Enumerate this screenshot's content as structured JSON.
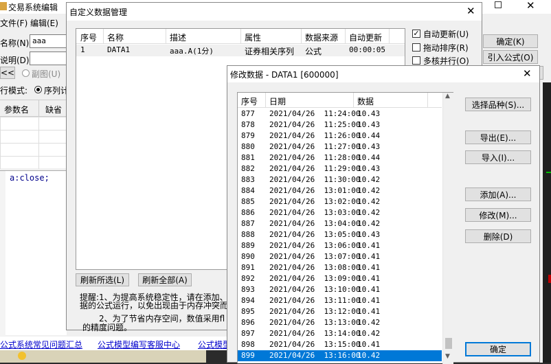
{
  "bg_window": {
    "title": "交易系统编辑",
    "menu_file": "文件(F)",
    "menu_edit": "编辑(E)",
    "name_label": "名称(N):",
    "name_value": "aaa",
    "desc_label": "说明(D):",
    "nav_back": "<<",
    "radio_subchart": "副图(U)",
    "run_mode_label": "行模式:",
    "radio_sequence": "序列计",
    "param_name_col": "参数名",
    "default_col": "缺省",
    "code_text": "a:close;",
    "link_faq": "公式系统常见问题汇总",
    "link_service": "公式模型编写客服中心",
    "link_other": "公式模型",
    "btn_ok": "确定(K)",
    "btn_import": "引入公式(O)"
  },
  "custom_data_dialog": {
    "title": "自定义数据管理",
    "columns": [
      "序号",
      "名称",
      "描述",
      "属性",
      "数据来源",
      "自动更新"
    ],
    "rows": [
      [
        "1",
        "DATA1",
        "aaa.A(1分)",
        "证券相关序列",
        "公式",
        "00:00:05"
      ]
    ],
    "options": [
      {
        "label": "自动更新(U)",
        "checked": true
      },
      {
        "label": "拖动排序(R)",
        "checked": false
      },
      {
        "label": "多核并行(O)",
        "checked": false
      }
    ],
    "btn_refresh_selected": "刷新所选(L)",
    "btn_refresh_all": "刷新全部(A)",
    "tip_line1": "提醒:1、为提高系统稳定性，请在添加、",
    "tip_line2": "据的公式运行，以免出现由于内存冲突而",
    "tip_line3": "2、为了节省内存空间，数值采用fl",
    "tip_line4": "的精度问题。"
  },
  "modify_dialog": {
    "title": "修改数据 - DATA1 [600000]",
    "columns": [
      "序号",
      "日期",
      "数据"
    ],
    "rows": [
      [
        "877",
        "2021/04/26  11:24:00",
        "10.43"
      ],
      [
        "878",
        "2021/04/26  11:25:00",
        "10.43"
      ],
      [
        "879",
        "2021/04/26  11:26:00",
        "10.44"
      ],
      [
        "880",
        "2021/04/26  11:27:00",
        "10.43"
      ],
      [
        "881",
        "2021/04/26  11:28:00",
        "10.44"
      ],
      [
        "882",
        "2021/04/26  11:29:00",
        "10.43"
      ],
      [
        "883",
        "2021/04/26  11:30:00",
        "10.42"
      ],
      [
        "884",
        "2021/04/26  13:01:00",
        "10.42"
      ],
      [
        "885",
        "2021/04/26  13:02:00",
        "10.42"
      ],
      [
        "886",
        "2021/04/26  13:03:00",
        "10.42"
      ],
      [
        "887",
        "2021/04/26  13:04:00",
        "10.42"
      ],
      [
        "888",
        "2021/04/26  13:05:00",
        "10.43"
      ],
      [
        "889",
        "2021/04/26  13:06:00",
        "10.41"
      ],
      [
        "890",
        "2021/04/26  13:07:00",
        "10.41"
      ],
      [
        "891",
        "2021/04/26  13:08:00",
        "10.41"
      ],
      [
        "892",
        "2021/04/26  13:09:00",
        "10.41"
      ],
      [
        "893",
        "2021/04/26  13:10:00",
        "10.41"
      ],
      [
        "894",
        "2021/04/26  13:11:00",
        "10.41"
      ],
      [
        "895",
        "2021/04/26  13:12:00",
        "10.41"
      ],
      [
        "896",
        "2021/04/26  13:13:00",
        "10.42"
      ],
      [
        "897",
        "2021/04/26  13:14:00",
        "10.42"
      ],
      [
        "898",
        "2021/04/26  13:15:00",
        "10.41"
      ],
      [
        "899",
        "2021/04/26  13:16:00",
        "10.42"
      ]
    ],
    "selected_index": 22,
    "btn_select_symbol": "选择品种(S)...",
    "btn_export": "导出(E)...",
    "btn_import": "导入(I)...",
    "btn_add": "添加(A)...",
    "btn_modify": "修改(M)...",
    "btn_delete": "删除(D)",
    "btn_ok": "确定"
  },
  "colors": {
    "selection": "#0078d7",
    "dialog_bg": "#f0f0f0",
    "dark_bg": "#2b2b2b"
  }
}
